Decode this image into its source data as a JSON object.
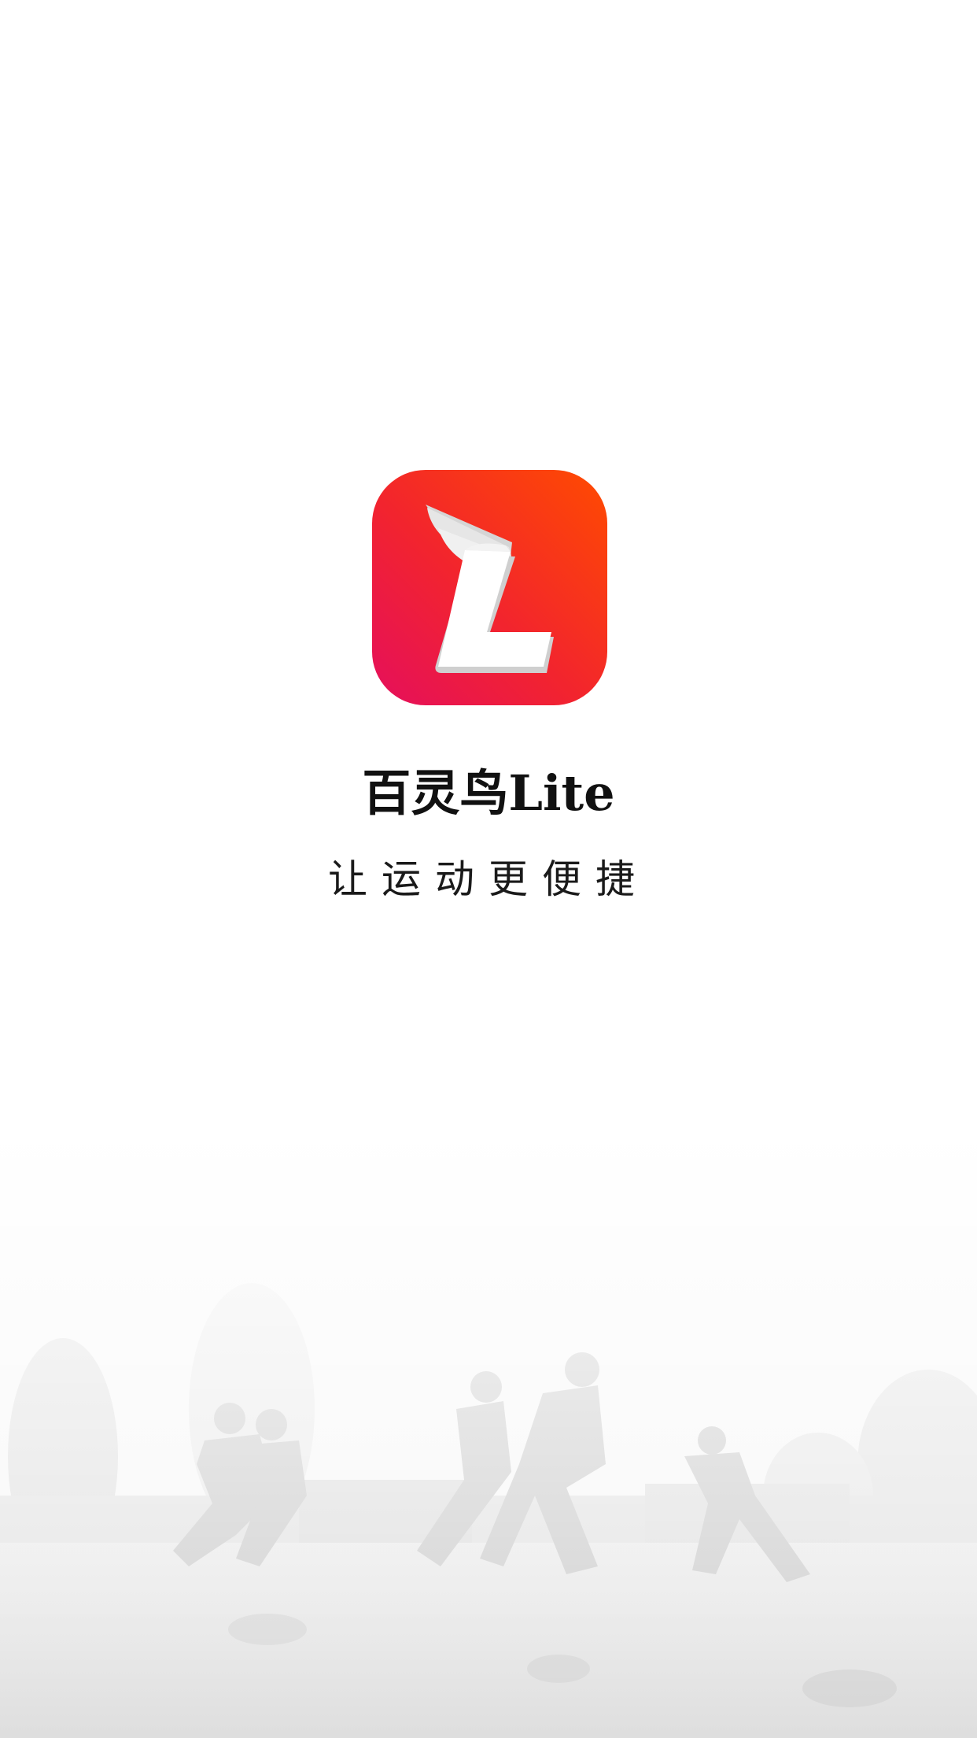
{
  "app": {
    "name": "百灵鸟Lite",
    "slogan": "让运动更便捷",
    "icon_letter": "L",
    "icon_name": "winged-l-logo-icon"
  },
  "background": {
    "scene": "football-training-photo"
  },
  "colors": {
    "icon_gradient_start": "#ff4b00",
    "icon_gradient_mid": "#f2242e",
    "icon_gradient_end": "#e50f5c",
    "text": "#111111",
    "page_background": "#ffffff"
  }
}
